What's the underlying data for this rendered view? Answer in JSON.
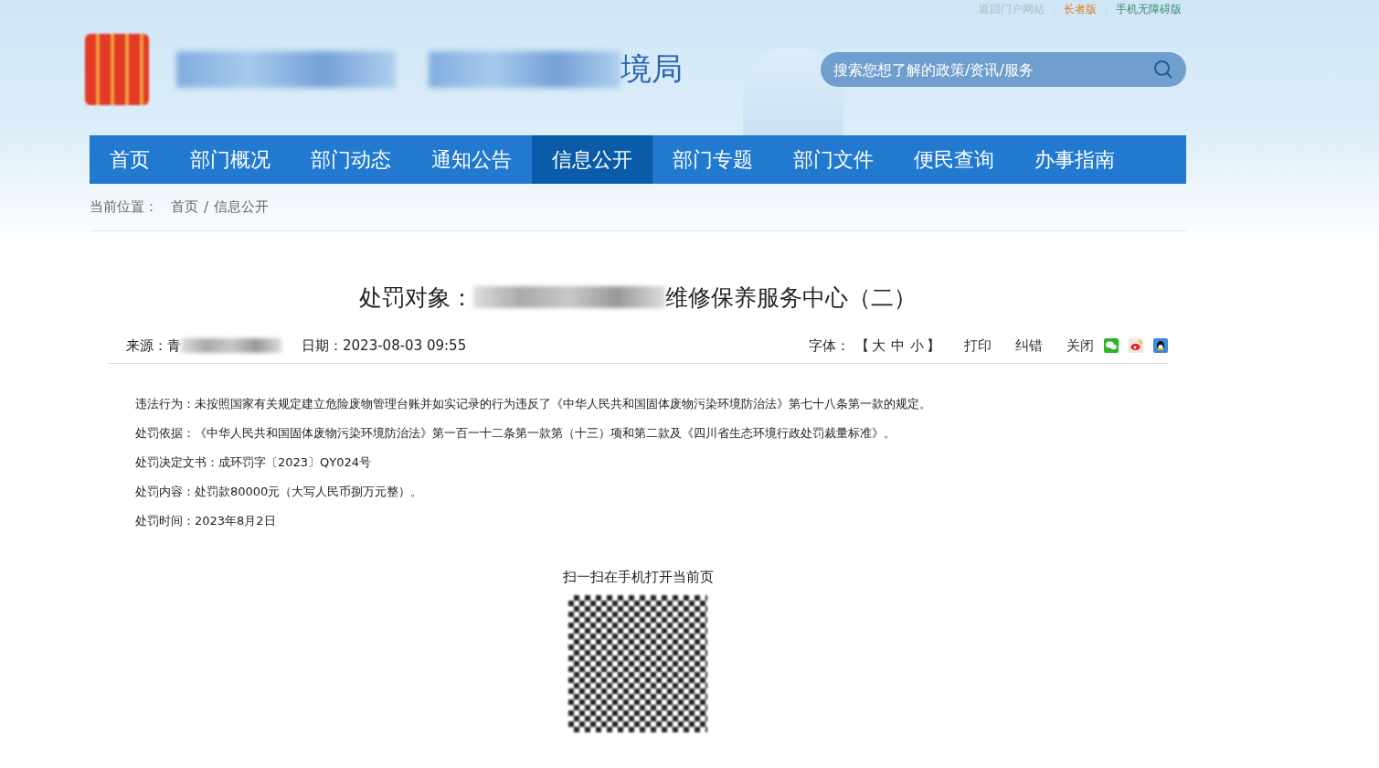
{
  "top_links": [
    {
      "label": "返回门户网站",
      "color": "#b0b8c0"
    },
    {
      "label": "长者版",
      "color": "#e07a20"
    },
    {
      "label": "手机无障碍版",
      "color": "#3a8a6a"
    }
  ],
  "header": {
    "site_name_visible": "境局"
  },
  "search": {
    "placeholder": "搜索您想了解的政策/资讯/服务"
  },
  "nav": [
    {
      "label": "首页",
      "selected": false
    },
    {
      "label": "部门概况",
      "selected": false
    },
    {
      "label": "部门动态",
      "selected": false
    },
    {
      "label": "通知公告",
      "selected": false
    },
    {
      "label": "信息公开",
      "selected": true
    },
    {
      "label": "部门专题",
      "selected": false
    },
    {
      "label": "部门文件",
      "selected": false
    },
    {
      "label": "便民查询",
      "selected": false
    },
    {
      "label": "办事指南",
      "selected": false
    }
  ],
  "breadcrumb": {
    "label": "当前位置：",
    "items": [
      "首页",
      "信息公开"
    ],
    "separator": "/"
  },
  "article": {
    "title_start": "处罚对象：",
    "title_end": "维修保养服务中心（二）",
    "source_label": "来源：青",
    "date": "日期：2023-08-03 09:55",
    "font_label": "字体：",
    "font_open": "【",
    "font_sizes": [
      "大",
      "中",
      "小"
    ],
    "font_close": "】",
    "actions": [
      "打印",
      "纠错",
      "关闭"
    ],
    "paragraphs": [
      "违法行为：未按照国家有关规定建立危险废物管理台账并如实记录的行为违反了《中华人民共和国固体废物污染环境防治法》第七十八条第一款的规定。",
      "处罚依据：《中华人民共和国固体废物污染环境防治法》第一百一十二条第一款第（十三）项和第二款及《四川省生态环境行政处罚裁量标准》。",
      "处罚决定文书：成环罚字〔2023〕QY024号",
      "处罚内容：处罚款80000元（大写人民币捌万元整）。",
      "处罚时间：2023年8月2日"
    ],
    "qr_caption": "扫一扫在手机打开当前页"
  }
}
